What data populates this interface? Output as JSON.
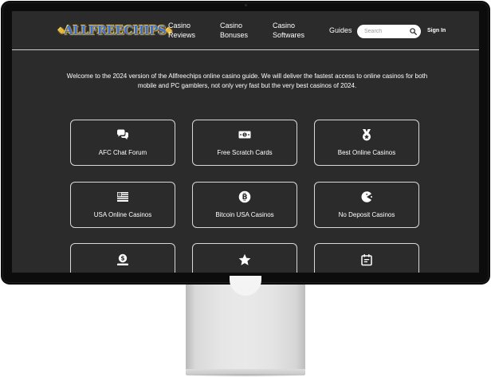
{
  "site": {
    "logo_text": "ALLFREECHIPS"
  },
  "nav": {
    "items": [
      {
        "line1": "Casino",
        "line2": "Reviews"
      },
      {
        "line1": "Casino",
        "line2": "Bonuses"
      },
      {
        "line1": "Casino",
        "line2": "Softwares"
      },
      {
        "line1": "Guides",
        "line2": ""
      }
    ],
    "search_placeholder": "Search",
    "search_value": "",
    "signin_label": "Sign In"
  },
  "intro": {
    "text": "Welcome to the 2024 version of the Allfreechips online casino guide. We will deliver the fastest access to online casinos for both mobile and PC gamblers, not only very fast but the very best casinos of 2024."
  },
  "cards": [
    {
      "label": "AFC Chat Forum",
      "icon": "chat-bubbles-icon"
    },
    {
      "label": "Free Scratch Cards",
      "icon": "money-bill-icon"
    },
    {
      "label": "Best Online Casinos",
      "icon": "medal-icon"
    },
    {
      "label": "USA Online Casinos",
      "icon": "us-flag-icon"
    },
    {
      "label": "Bitcoin USA Casinos",
      "icon": "bitcoin-icon"
    },
    {
      "label": "No Deposit Casinos",
      "icon": "pacman-icon"
    },
    {
      "label": "",
      "icon": "dollar-hand-icon"
    },
    {
      "label": "",
      "icon": "star-icon"
    },
    {
      "label": "",
      "icon": "calendar-icon"
    }
  ],
  "colors": {
    "page_background": "#2b2b2b",
    "text": "#ffffff",
    "card_border": "#d8d8d8"
  }
}
